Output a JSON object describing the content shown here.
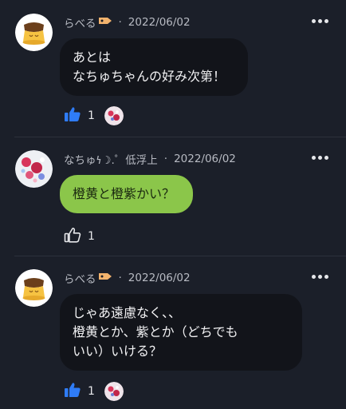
{
  "messages": [
    {
      "author": "らべる",
      "date": "2022/06/02",
      "text_lines": [
        "あとは",
        "なちゅちゃんの好み次第！"
      ],
      "likes": "1",
      "liked": true
    },
    {
      "author": "なちゅ𐓏☽.゜低浮上",
      "date": "2022/06/02",
      "text_lines": [
        "橙黄と橙紫かい？"
      ],
      "likes": "1",
      "liked": false
    },
    {
      "author": "らべる",
      "date": "2022/06/02",
      "text_lines": [
        "じゃあ遠慮なく、、",
        "橙黄とか、紫とか（どちでも",
        "いい）いける？"
      ],
      "likes": "1",
      "liked": true
    }
  ],
  "separator": "·",
  "colors": {
    "background": "#1b1f29",
    "bubble_dark": "#12141a",
    "bubble_green": "#8bc64a",
    "like_blue": "#2f7cf6"
  },
  "icons": {
    "more": "more-dots-icon",
    "like": "thumbs-up-icon",
    "tag": "tag-icon"
  }
}
